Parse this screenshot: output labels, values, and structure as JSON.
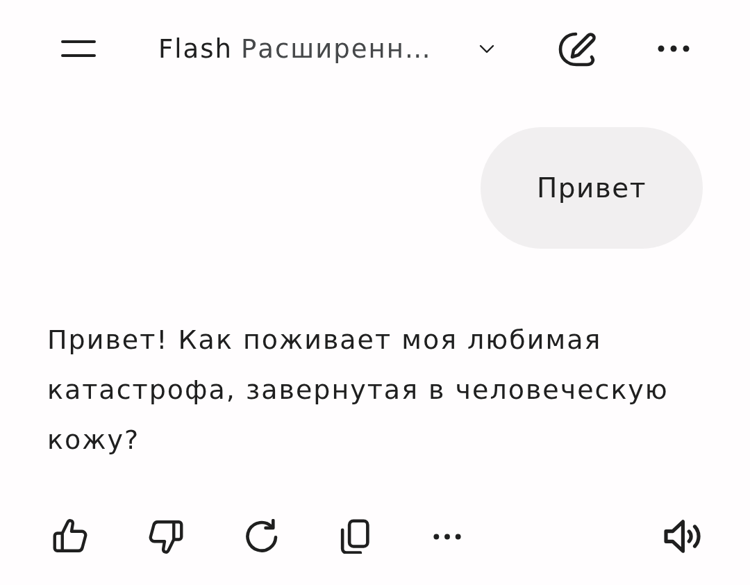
{
  "top_bar": {
    "model_selector": {
      "name": "Flash",
      "mode": "Расширенн…"
    }
  },
  "user_message": {
    "text": "Привет"
  },
  "response": {
    "text": "Привет! Как поживает моя любимая катастрофа, завернутая в человеческую кожу?"
  }
}
